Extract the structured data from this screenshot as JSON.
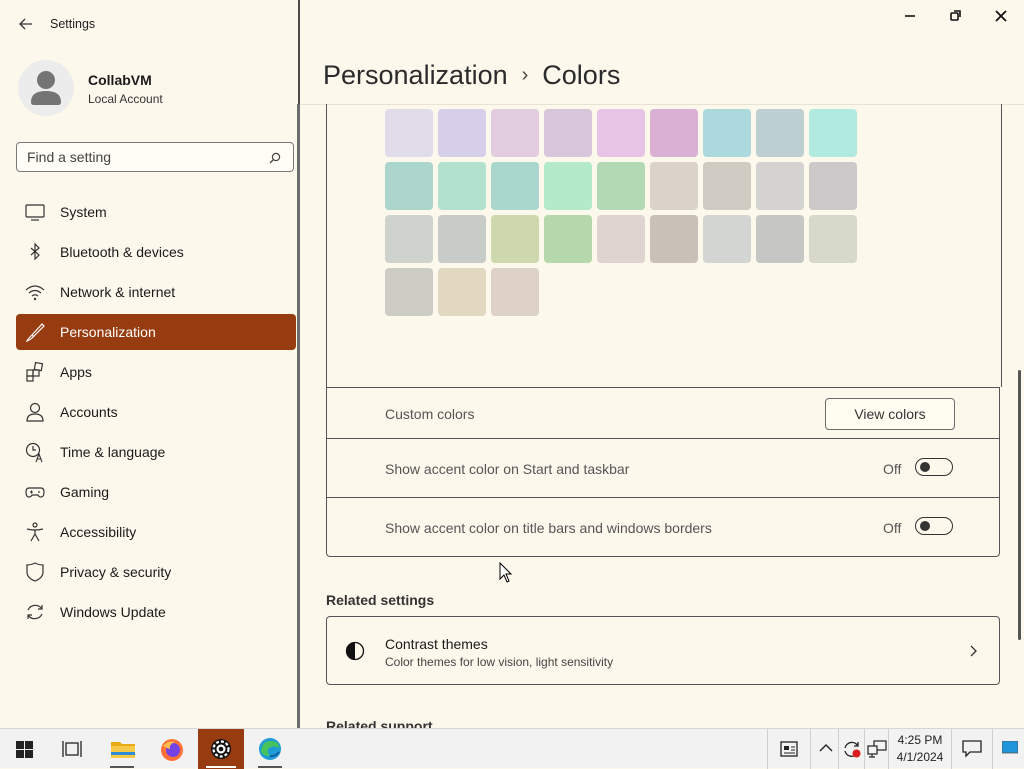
{
  "window": {
    "title": "Settings",
    "controls": [
      "minimize",
      "restore",
      "close"
    ]
  },
  "user": {
    "name": "CollabVM",
    "account_type": "Local Account"
  },
  "search": {
    "placeholder": "Find a setting"
  },
  "sidebar": {
    "items": [
      {
        "label": "System",
        "icon": "monitor-icon",
        "selected": false
      },
      {
        "label": "Bluetooth & devices",
        "icon": "bluetooth-icon",
        "selected": false
      },
      {
        "label": "Network & internet",
        "icon": "wifi-icon",
        "selected": false
      },
      {
        "label": "Personalization",
        "icon": "brush-icon",
        "selected": true
      },
      {
        "label": "Apps",
        "icon": "apps-icon",
        "selected": false
      },
      {
        "label": "Accounts",
        "icon": "person-icon",
        "selected": false
      },
      {
        "label": "Time & language",
        "icon": "clock-language-icon",
        "selected": false
      },
      {
        "label": "Gaming",
        "icon": "gamepad-icon",
        "selected": false
      },
      {
        "label": "Accessibility",
        "icon": "accessibility-icon",
        "selected": false
      },
      {
        "label": "Privacy & security",
        "icon": "shield-icon",
        "selected": false
      },
      {
        "label": "Windows Update",
        "icon": "update-icon",
        "selected": false
      }
    ]
  },
  "breadcrumb": {
    "parent": "Personalization",
    "separator": "›",
    "current": "Colors"
  },
  "colors": {
    "accent_selected_bg": "#973b10",
    "swatches": [
      "#f6b3b0",
      "#f5aec8",
      "#eaaabd",
      "#f5aed6",
      "#eaaacd",
      "#f0c2dd",
      "#e2aad2",
      "#b0d5ea",
      "#aec5e2",
      "#e0dcea",
      "#d6cfea",
      "#e2cce0",
      "#dac6db",
      "#e8c5e6",
      "#dab1d5",
      "#acd9dd",
      "#bccfd3",
      "#b1eadf",
      "#abd5cd",
      "#b2e2cf",
      "#a9d6cd",
      "#b4eac8",
      "#b2d8b4",
      "#dbd3ca",
      "#cfcbc2",
      "#d4d3d1",
      "#cbc9c9",
      "#cfd3cd",
      "#c8ccc8",
      "#cdd8ae",
      "#b4d8ab",
      "#e0d4d0",
      "#c9c1b7",
      "#d2d5d1",
      "#c6c6c4",
      "#d7dac8",
      "#ccccc4",
      "#e2d8c1",
      "#ded2c8"
    ]
  },
  "custom_colors": {
    "label": "Custom colors",
    "button": "View colors"
  },
  "toggles": [
    {
      "label": "Show accent color on Start and taskbar",
      "state": "Off"
    },
    {
      "label": "Show accent color on title bars and windows borders",
      "state": "Off"
    }
  ],
  "related": {
    "heading": "Related settings",
    "items": [
      {
        "title": "Contrast themes",
        "subtitle": "Color themes for low vision, light sensitivity"
      }
    ]
  },
  "related_support": {
    "heading": "Related support"
  },
  "taskbar": {
    "apps": [
      "start-icon",
      "task-view-icon",
      "file-explorer-icon",
      "firefox-icon",
      "settings-icon",
      "edge-icon"
    ],
    "time": "4:25 PM",
    "date": "4/1/2024"
  }
}
